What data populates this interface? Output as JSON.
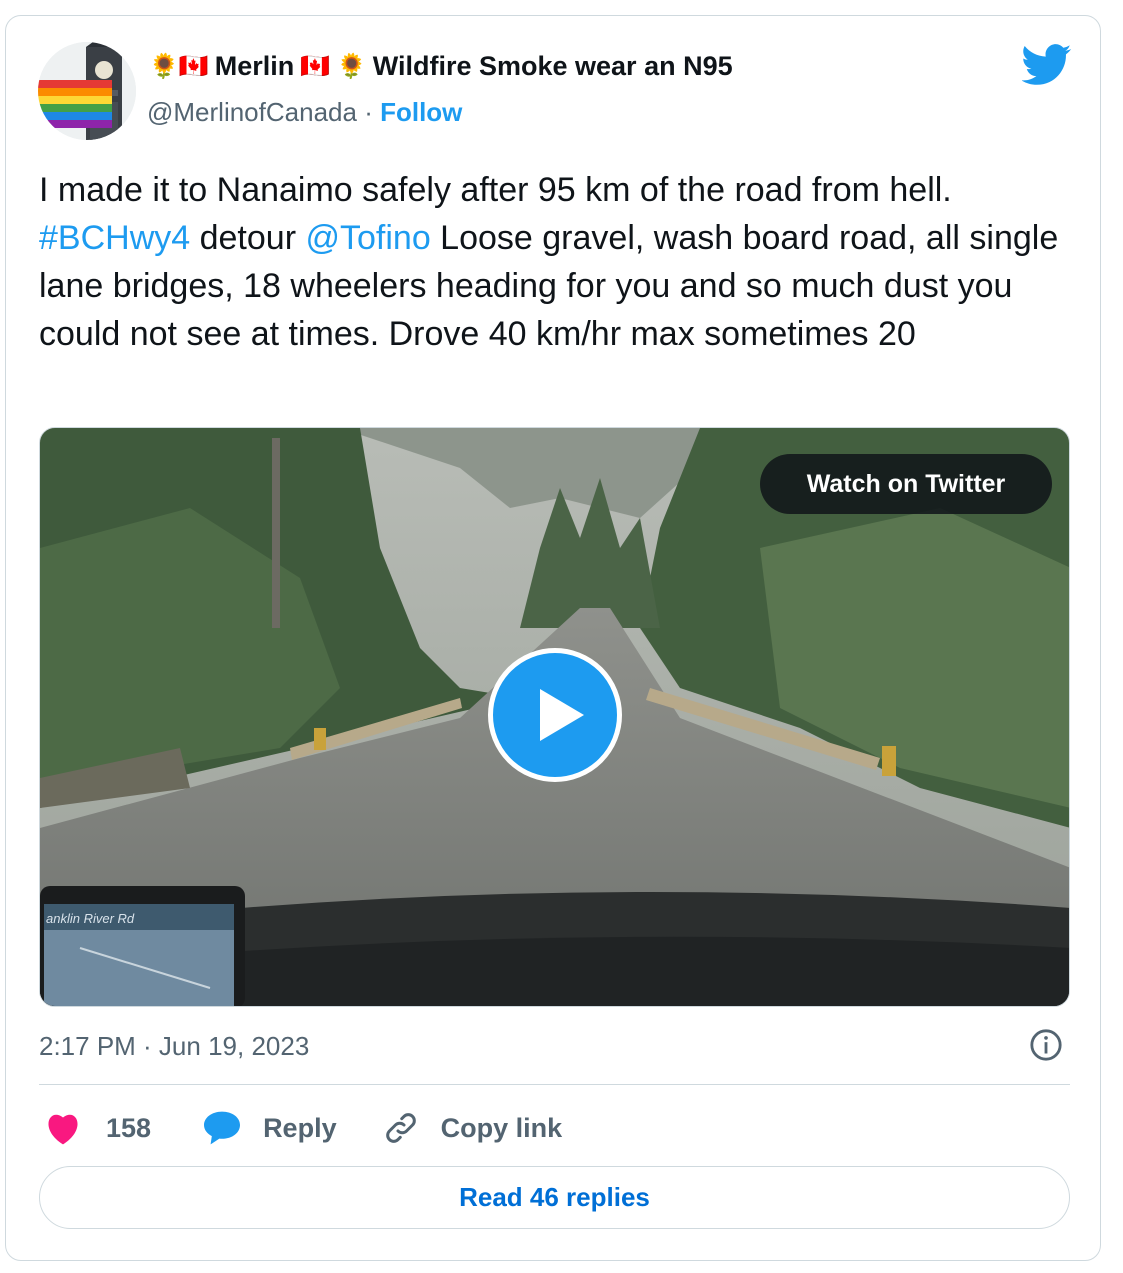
{
  "author": {
    "display_name_prefix": "🌻🇨🇦",
    "display_name": "Merlin",
    "display_name_mid": "🇨🇦 🌻",
    "display_name_suffix": "Wildfire Smoke wear an N95",
    "handle": "@MerlinofCanada",
    "separator": "·",
    "follow_label": "Follow",
    "avatar_icon": "rainbow-flag-clock-tower"
  },
  "brand_icon": "twitter-bird-icon",
  "tweet": {
    "text_part1": "I made it to Nanaimo safely after  95 km of the road from hell. ",
    "hashtag": "#BCHwy4",
    "text_part2": " detour ",
    "mention": "@Tofino",
    "text_part3": " Loose gravel, wash board road, all single lane bridges, 18 wheelers heading for you and so much dust you could not see at times. Drove 40 km/hr max sometimes 20"
  },
  "media": {
    "watch_label": "Watch on Twitter",
    "play_icon": "play-icon",
    "gps_text": "anklin River Rd"
  },
  "meta": {
    "timestamp": "2:17 PM · Jun 19, 2023",
    "info_icon": "info-icon"
  },
  "actions": {
    "like_count": "158",
    "reply_label": "Reply",
    "copy_label": "Copy link"
  },
  "read_replies_label": "Read 46 replies",
  "colors": {
    "accent": "#1d9bf0",
    "like": "#f91880",
    "muted": "#536471",
    "border": "#cfd9de",
    "link_dark": "#006fd6"
  }
}
